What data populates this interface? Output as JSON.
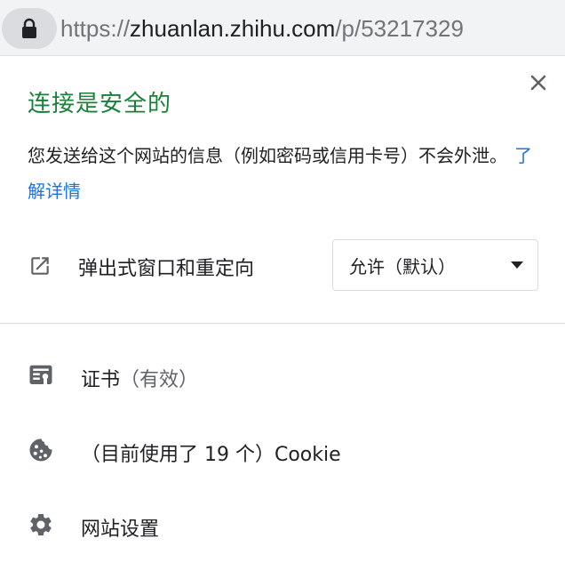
{
  "address_bar": {
    "scheme": "https://",
    "host": "zhuanlan.zhihu.com",
    "path": "/p/53217329",
    "lock_icon": "lock-icon"
  },
  "popup": {
    "title": "连接是安全的",
    "title_color": "#188038",
    "description": "您发送给这个网站的信息（例如密码或信用卡号）不会外泄。",
    "learn_more": "了解详情",
    "close_icon": "close-icon",
    "permission": {
      "icon": "open-in-new-icon",
      "label": "弹出式窗口和重定向",
      "selected": "允许（默认）"
    },
    "items": [
      {
        "icon": "certificate-icon",
        "label": "证书",
        "detail": "（有效）"
      },
      {
        "icon": "cookie-icon",
        "label": "（目前使用了 19 个）Cookie"
      },
      {
        "icon": "gear-icon",
        "label": "网站设置"
      }
    ]
  }
}
